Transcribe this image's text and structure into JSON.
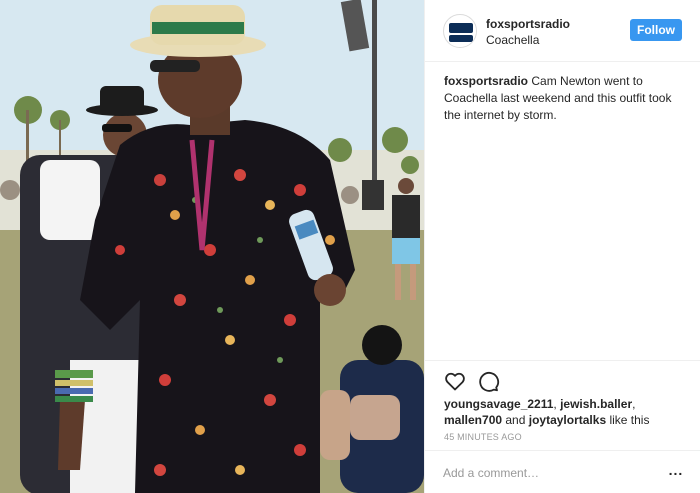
{
  "post": {
    "account": {
      "username": "foxsportsradio",
      "location": "Coachella",
      "avatar_icon": "fox-sports-radio-logo",
      "follow_label": "Follow"
    },
    "caption": {
      "username": "foxsportsradio",
      "text": "Cam Newton went to Coachella last weekend and this outfit took the internet by storm."
    },
    "actions": {
      "like_icon": "heart-icon",
      "comment_icon": "comment-icon"
    },
    "likes": {
      "user1": "youngsavage_2211",
      "sep1": ", ",
      "user2": "jewish.baller",
      "sep2": ",",
      "user3": "mallen700",
      "and_text": " and ",
      "user4": "joytaylortalks",
      "suffix": " like this"
    },
    "timestamp": "45 MINUTES AGO",
    "comment_box": {
      "placeholder": "Add a comment…",
      "more_label": "..."
    }
  },
  "colors": {
    "accent": "#3897f0",
    "text": "#262626",
    "muted": "#999999",
    "border": "#efefef"
  }
}
